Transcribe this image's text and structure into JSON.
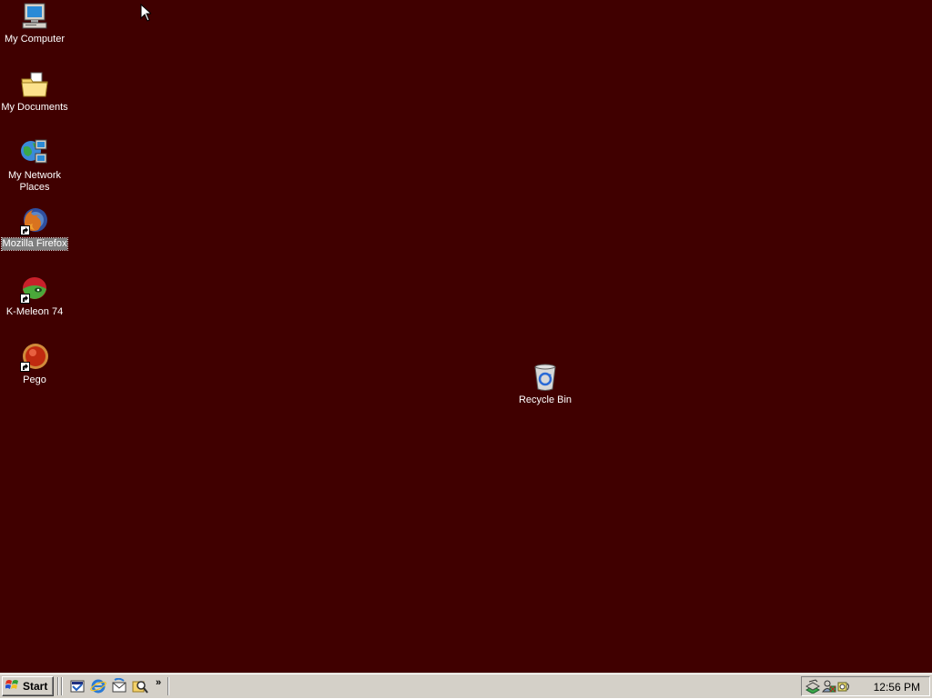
{
  "desktop": {
    "background_color": "#400000",
    "icons": [
      {
        "label": "My Computer",
        "icon": "my-computer-icon"
      },
      {
        "label": "My Documents",
        "icon": "my-documents-icon"
      },
      {
        "label": "My Network Places",
        "icon": "network-places-icon"
      },
      {
        "label": "Mozilla Firefox",
        "icon": "firefox-icon",
        "selected": true
      },
      {
        "label": "K-Meleon 74",
        "icon": "k-meleon-icon"
      },
      {
        "label": "Pego",
        "icon": "pego-icon"
      },
      {
        "label": "Recycle Bin",
        "icon": "recycle-bin-icon"
      }
    ]
  },
  "taskbar": {
    "start_label": "Start",
    "quick_launch": [
      "show-desktop-icon",
      "internet-explorer-icon",
      "outlook-express-icon",
      "search-icon"
    ],
    "more_label": "»",
    "tray_icons": [
      "network-tray-icon",
      "users-tray-icon",
      "volume-tray-icon"
    ],
    "clock": "12:56 PM"
  }
}
